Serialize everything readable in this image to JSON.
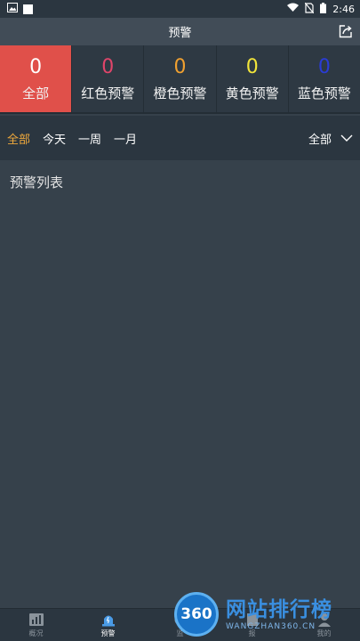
{
  "status_bar": {
    "time": "2:46"
  },
  "header": {
    "title": "预警"
  },
  "tiles": [
    {
      "count": "0",
      "label": "全部",
      "color": "#ffffff",
      "active": true
    },
    {
      "count": "0",
      "label": "红色预警",
      "color": "#e0456a",
      "active": false
    },
    {
      "count": "0",
      "label": "橙色预警",
      "color": "#f0a030",
      "active": false
    },
    {
      "count": "0",
      "label": "黄色预警",
      "color": "#f2e53a",
      "active": false
    },
    {
      "count": "0",
      "label": "蓝色预警",
      "color": "#2a3cd6",
      "active": false
    }
  ],
  "filters": {
    "items": [
      "全部",
      "今天",
      "一周",
      "一月"
    ],
    "active_index": 0,
    "select_value": "全部"
  },
  "list": {
    "title": "预警列表"
  },
  "bottom_nav": [
    {
      "label": "概况",
      "icon": "chart-icon"
    },
    {
      "label": "预警",
      "icon": "alert-icon"
    },
    {
      "label": "监",
      "icon": "monitor-icon"
    },
    {
      "label": "报",
      "icon": "report-icon"
    },
    {
      "label": "我的",
      "icon": "user-icon"
    }
  ],
  "watermark": {
    "badge": "360",
    "main": "网站排行榜",
    "sub": "WANGZHAN360.CN"
  }
}
